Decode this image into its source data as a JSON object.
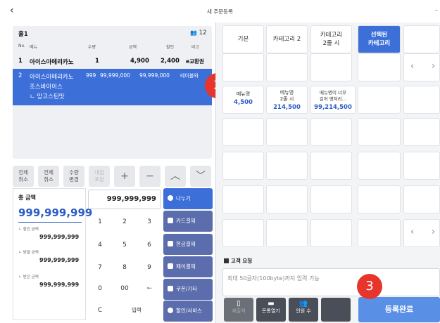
{
  "header": {
    "back_icon": "‹",
    "title": "새 주문등록",
    "dash": "–"
  },
  "order": {
    "table_name": "홀1",
    "people_icon": "👥",
    "people_count": "12",
    "columns": [
      "No.",
      "메뉴",
      "수량",
      "금액",
      "할인",
      "비고"
    ],
    "rows": [
      {
        "no": "1",
        "menu": "아이스아메리카노",
        "qty": "1",
        "amount": "4,900",
        "discount": "2,400",
        "note": "e교환권"
      },
      {
        "no": "2",
        "menu": "아이스아메리카노",
        "qty": "999",
        "amount": "99,999,000",
        "discount": "99,999,000",
        "note": "테이블와",
        "sub1": "조스바아이스",
        "sub2": "ㄴ 망고스틴맛"
      }
    ]
  },
  "badges": {
    "b2": "2",
    "b3": "3"
  },
  "functions": {
    "cancel_all": "전체\n취소",
    "cancel_all_2": "전체\n취소",
    "qty_change": "수량\n변경",
    "packing": "내점\n포장",
    "plus": "+",
    "minus": "−",
    "up": "︿",
    "down": "﹀"
  },
  "totals": {
    "total_label": "총 금액",
    "total_amount": "999,999,999",
    "discount_label": "ㄴ 할인 금액",
    "discount_value": "999,999,999",
    "received_label": "ㄴ 받을 금액",
    "received_value": "999,999,999",
    "paid_label": "ㄴ 받은 금액",
    "paid_value": "999,999,999"
  },
  "keypad": {
    "display": "999,999,999",
    "keys": [
      "1",
      "2",
      "3",
      "4",
      "5",
      "6",
      "7",
      "8",
      "9",
      "0",
      "00",
      "⇽",
      "C",
      "입력"
    ]
  },
  "payments": [
    "나누기",
    "카드결제",
    "현금결제",
    "페이결제",
    "쿠폰/기타",
    "할인/서비스"
  ],
  "categories": [
    {
      "label": "기본"
    },
    {
      "label": "카테고리 2"
    },
    {
      "label": "카테고리\n2줄 시"
    },
    {
      "label": "선택된\n카테고리"
    }
  ],
  "menus": [
    {
      "name": "메뉴명",
      "price": "4,500"
    },
    {
      "name": "메뉴명\n2줄 시",
      "price": "214,500"
    },
    {
      "name": "메뉴명이 너무\n길어 맹처리…",
      "price": "99,214,500"
    }
  ],
  "nav": {
    "left": "‹",
    "right": "›"
  },
  "request": {
    "label": "고객 요청",
    "placeholder": "최대 50글자(100byte)까지 입력 가능"
  },
  "bottom": {
    "reorder": "재출력",
    "drawer": "돈통열기",
    "people": "인원 수",
    "submit": "등록완료"
  }
}
